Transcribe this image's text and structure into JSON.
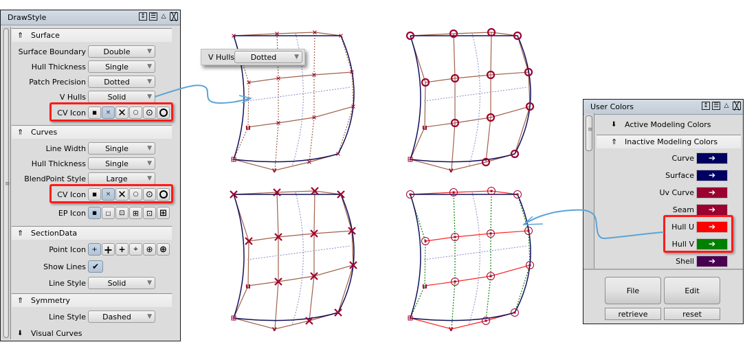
{
  "drawstyle": {
    "title": "DrawStyle",
    "titlebar_icons": [
      "resize-icon",
      "menu-icon",
      "collapse-icon",
      "close-icon"
    ],
    "sections": {
      "surface": {
        "label": "Surface",
        "surface_boundary": {
          "label": "Surface Boundary",
          "value": "Double"
        },
        "hull_thickness": {
          "label": "Hull Thickness",
          "value": "Single"
        },
        "patch_precision": {
          "label": "Patch Precision",
          "value": "Dotted"
        },
        "v_hulls": {
          "label": "V Hulls",
          "value": "Solid"
        },
        "cv_icon": {
          "label": "CV Icon",
          "options": [
            "small-dot",
            "small-x",
            "large-x",
            "small-circle",
            "dot-circle",
            "large-circle"
          ],
          "selected_index": 1
        }
      },
      "curves": {
        "label": "Curves",
        "line_width": {
          "label": "Line Width",
          "value": "Single"
        },
        "hull_thickness": {
          "label": "Hull Thickness",
          "value": "Single"
        },
        "blendpoint_style": {
          "label": "BlendPoint Style",
          "value": "Large"
        },
        "cv_icon": {
          "label": "CV Icon",
          "options": [
            "small-dot",
            "small-x",
            "large-x",
            "small-circle",
            "dot-circle",
            "large-circle"
          ],
          "selected_index": 1
        },
        "ep_icon": {
          "label": "EP Icon",
          "options": [
            "small-square",
            "hollow-square",
            "dotted-square",
            "grid-square",
            "dot-square",
            "plus-square"
          ],
          "selected_index": 0
        }
      },
      "section_data": {
        "label": "SectionData",
        "point_icon": {
          "label": "Point Icon",
          "options": [
            "small-plus",
            "large-plus",
            "bold-plus",
            "cross-hair-small",
            "cross-hair-medium",
            "cross-hair-large"
          ],
          "selected_index": 0
        },
        "show_lines": {
          "label": "Show Lines",
          "checked": true
        },
        "line_style": {
          "label": "Line Style",
          "value": "Solid"
        }
      },
      "symmetry": {
        "label": "Symmetry",
        "line_style": {
          "label": "Line Style",
          "value": "Dashed"
        }
      },
      "visual_curves": {
        "label": "Visual Curves"
      }
    }
  },
  "floating_dropdown": {
    "label": "V Hulls",
    "value": "Dotted"
  },
  "user_colors": {
    "title": "User Colors",
    "active_header": "Active Modeling Colors",
    "inactive_header": "Inactive Modeling Colors",
    "colors": [
      {
        "label": "Curve",
        "color": "#000060"
      },
      {
        "label": "Surface",
        "color": "#000060"
      },
      {
        "label": "Uv Curve",
        "color": "#9a0030"
      },
      {
        "label": "Seam",
        "color": "#9a0030"
      },
      {
        "label": "Hull U",
        "color": "#ff0000"
      },
      {
        "label": "Hull V",
        "color": "#008000"
      },
      {
        "label": "Shell",
        "color": "#4a0050"
      }
    ],
    "buttons": {
      "file": "File",
      "edit": "Edit",
      "retrieve": "retrieve",
      "reset": "reset"
    }
  },
  "glyphs": {
    "section_open": "⇑",
    "section_closed": "🡇",
    "caret": "▼",
    "swatch_arrow": "➔",
    "checkmark": "✔",
    "u_marker": "u",
    "v_marker": "v"
  },
  "viewports": [
    {
      "name": "viewport-dotted-hulls",
      "cv_icon": "small-x",
      "hull_style": "dotted"
    },
    {
      "name": "viewport-large-circle-cv",
      "cv_icon": "large-circle",
      "hull_style": "solid"
    },
    {
      "name": "viewport-large-x-cv",
      "cv_icon": "large-x",
      "hull_style": "solid"
    },
    {
      "name": "viewport-colored-hulls",
      "cv_icon": "dot-circle",
      "hull_style": "colored"
    }
  ]
}
